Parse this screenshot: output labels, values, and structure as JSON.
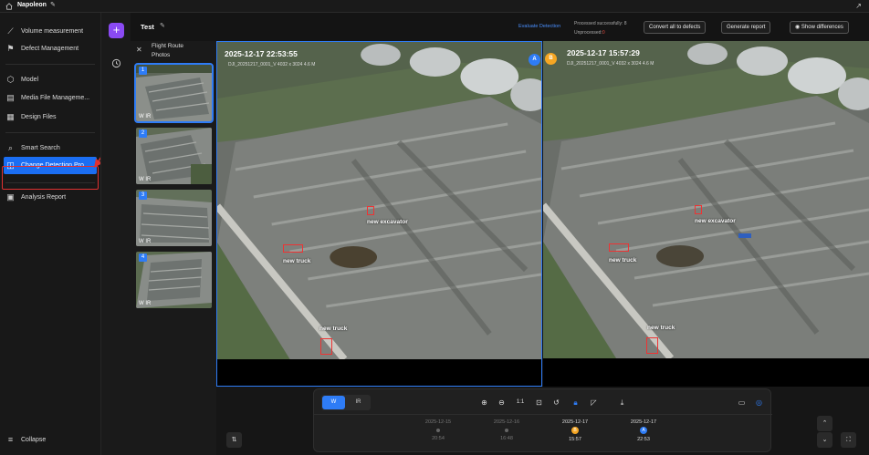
{
  "topbar": {
    "project": "Napoleon"
  },
  "sidebar": {
    "items": [
      {
        "label": "Volume measurement",
        "icon": "ruler-icon"
      },
      {
        "label": "Defect Management",
        "icon": "flag-icon"
      },
      {
        "label": "Model",
        "icon": "cube-icon"
      },
      {
        "label": "Media File Manageme...",
        "icon": "media-icon"
      },
      {
        "label": "Design Files",
        "icon": "file-icon"
      },
      {
        "label": "Smart Search",
        "icon": "search-icon"
      },
      {
        "label": "Change Detection Pro",
        "icon": "compare-icon"
      },
      {
        "label": "Analysis Report",
        "icon": "report-icon"
      }
    ],
    "collapse_label": "Collapse"
  },
  "header": {
    "title": "Test",
    "evaluate_link": "Evaluate Detection",
    "status_success": "Processed successfully: 8",
    "status_unprocessed": "Unprocessed:",
    "status_unprocessed_count": "0",
    "btn_convert": "Convert all to defects",
    "btn_report": "Generate report",
    "btn_diff": "Show differences"
  },
  "photos": {
    "title": "Flight Route Photos",
    "thumbs": [
      {
        "num": "1",
        "mode": "W IR"
      },
      {
        "num": "2",
        "mode": "W IR"
      },
      {
        "num": "3",
        "mode": "W IR"
      },
      {
        "num": "4",
        "mode": "W IR"
      }
    ]
  },
  "left_panel": {
    "badge": "A",
    "timestamp": "2025-12-17 22:53:55",
    "meta": "DJI_20251217_0001_V   4032 x 3024   4.6 M",
    "labels": [
      "new excavator",
      "new truck",
      "new truck"
    ]
  },
  "right_panel": {
    "badge": "B",
    "timestamp": "2025-12-17 15:57:29",
    "meta": "DJI_20251217_0001_V   4032 x 3024   4.6 M",
    "labels": [
      "new excavator",
      "new truck",
      "new truck"
    ]
  },
  "toolbar": {
    "seg_w": "W",
    "seg_ir": "IR",
    "zoom_ratio": "1:1"
  },
  "timeline": [
    {
      "date": "2025-12-15",
      "time": "20:54",
      "marker": ""
    },
    {
      "date": "2025-12-16",
      "time": "16:48",
      "marker": ""
    },
    {
      "date": "2025-12-17",
      "time": "15:57",
      "marker": "B"
    },
    {
      "date": "2025-12-17",
      "time": "22:53",
      "marker": "A"
    }
  ],
  "colors": {
    "accent": "#2e7cf6",
    "marker_a": "#2e7cf6",
    "marker_b": "#f5a623",
    "callout": "#e03131"
  }
}
